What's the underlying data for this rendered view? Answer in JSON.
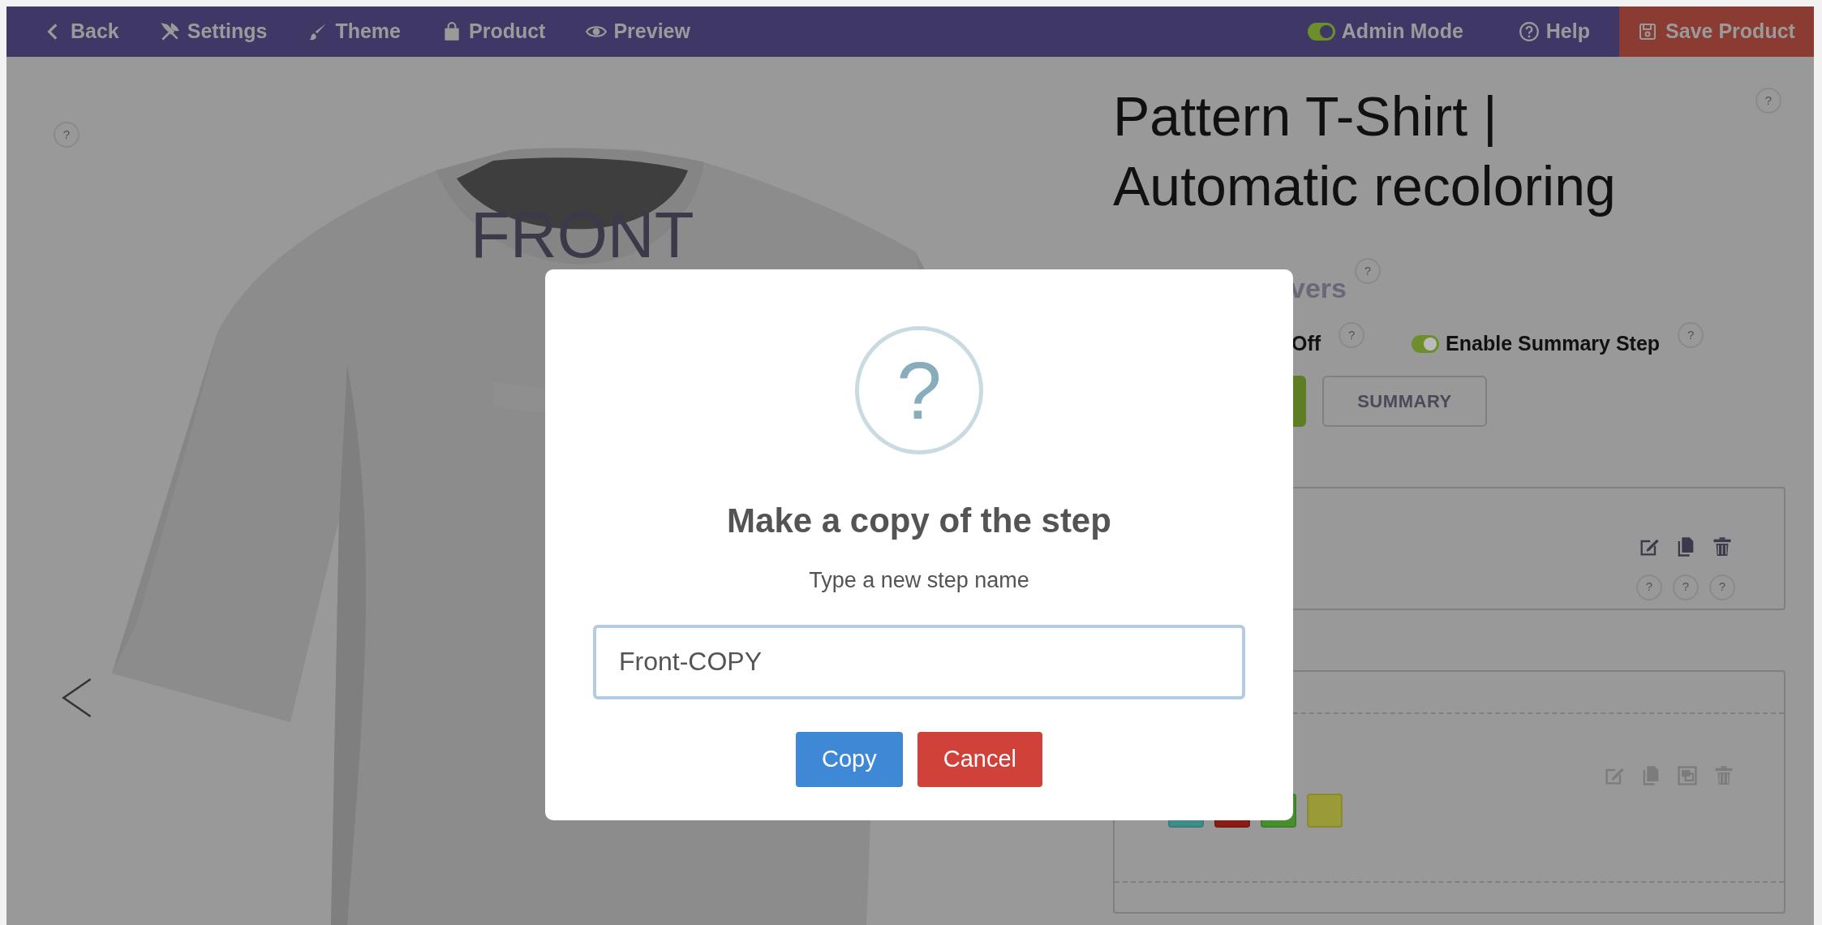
{
  "toolbar": {
    "left_items": [
      {
        "label": "Back",
        "kind": "back"
      },
      {
        "label": "Settings",
        "kind": "tools"
      },
      {
        "label": "Theme",
        "kind": "brush"
      },
      {
        "label": "Product",
        "kind": "bag"
      },
      {
        "label": "Preview",
        "kind": "eye"
      }
    ],
    "admin_mode": {
      "label": "Admin Mode",
      "on": true
    },
    "help": {
      "label": "Help"
    },
    "save_button": {
      "label": "Save Product"
    }
  },
  "preview": {
    "help": "?",
    "view_label": "FRONT"
  },
  "product": {
    "title": "Pattern T-Shirt | Automatic recoloring",
    "help": "?"
  },
  "settings": {
    "section_title": "vers",
    "section_help": "?",
    "options": [
      {
        "kind": "text",
        "label": "Off",
        "help": "?"
      },
      {
        "kind": "toggle",
        "label": "Enable Summary Step",
        "on": true,
        "help": "?"
      }
    ],
    "step_tabs": [
      {
        "selected": true
      },
      {
        "label": "SUMMARY",
        "selected": false
      }
    ]
  },
  "step_card": {
    "actions": [
      {
        "kind": "edit",
        "help": "?"
      },
      {
        "kind": "copy",
        "help": "?"
      },
      {
        "kind": "delete",
        "help": "?"
      }
    ]
  },
  "layer_card": {
    "actions": [
      {
        "kind": "edit"
      },
      {
        "kind": "copy"
      },
      {
        "kind": "resize"
      },
      {
        "kind": "delete"
      }
    ],
    "swatches": [
      {
        "color": "#3f8d8a"
      },
      {
        "color": "#8a1c14"
      },
      {
        "color": "#478f2c"
      },
      {
        "color": "#9a9a38"
      }
    ]
  },
  "dialog": {
    "icon": "?",
    "title": "Make a copy of the step",
    "message": "Type a new step name",
    "value": "Front-COPY",
    "buttons": [
      {
        "label": "Copy",
        "kind": "primary"
      },
      {
        "label": "Cancel",
        "kind": "danger"
      }
    ]
  }
}
